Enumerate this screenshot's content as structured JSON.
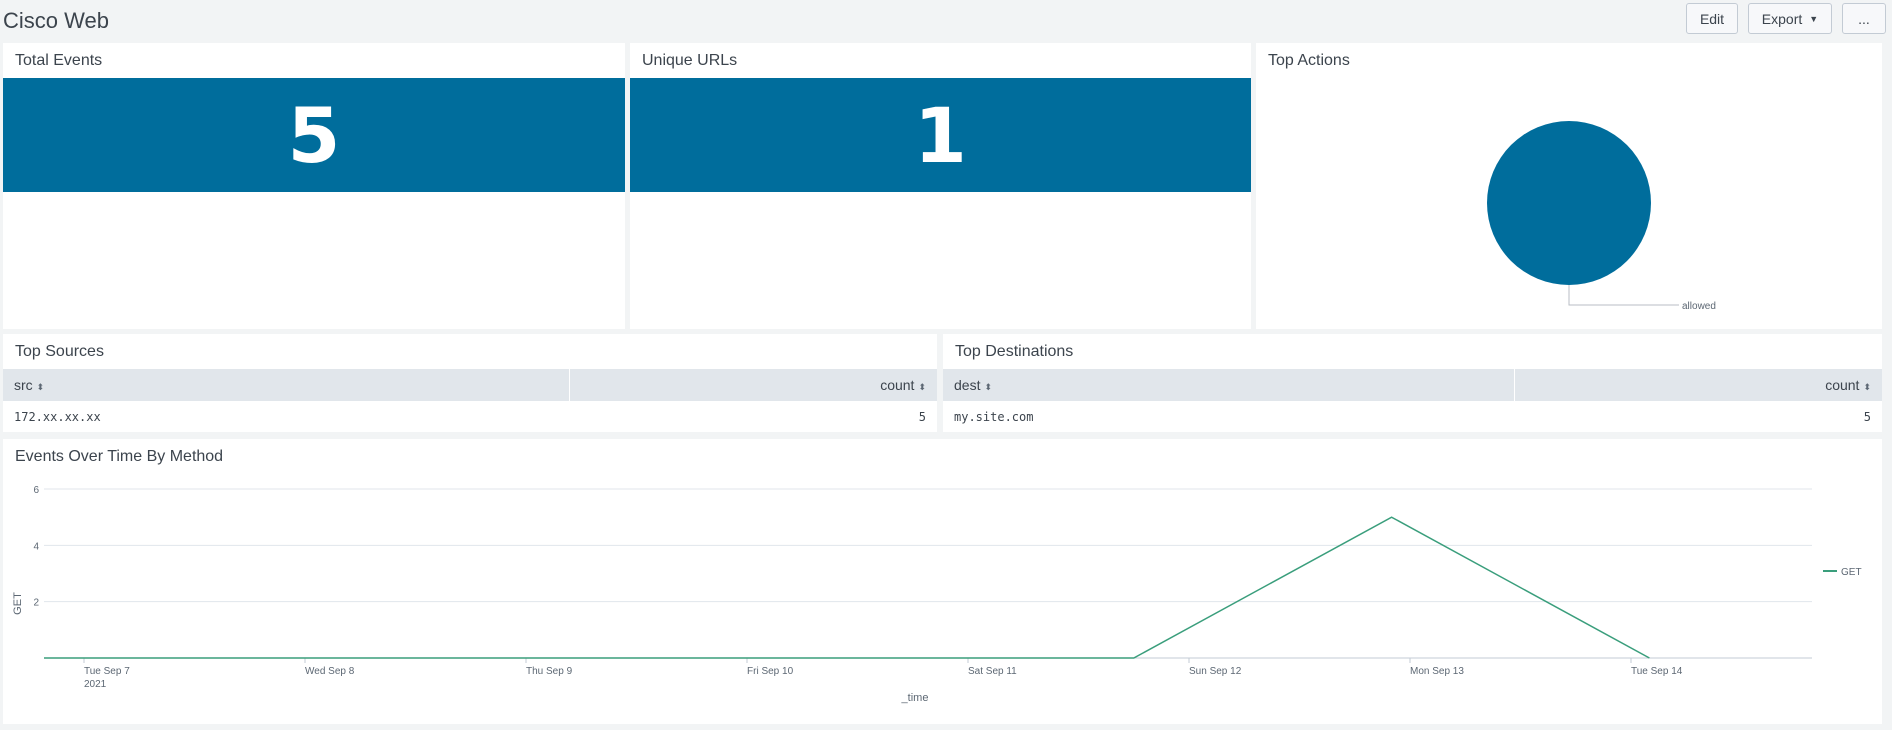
{
  "dashboard": {
    "title": "Cisco Web",
    "buttons": {
      "edit": "Edit",
      "export": "Export",
      "more": "..."
    }
  },
  "panels": {
    "total_events": {
      "title": "Total Events",
      "value": "5"
    },
    "unique_urls": {
      "title": "Unique URLs",
      "value": "1"
    },
    "top_actions": {
      "title": "Top Actions"
    },
    "top_sources": {
      "title": "Top Sources",
      "columns": [
        "src",
        "count"
      ],
      "rows": [
        {
          "src": "172.xx.xx.xx",
          "count": "5"
        }
      ]
    },
    "top_destinations": {
      "title": "Top Destinations",
      "columns": [
        "dest",
        "count"
      ],
      "rows": [
        {
          "dest": "my.site.com",
          "count": "5"
        }
      ]
    },
    "events_over_time": {
      "title": "Events Over Time By Method"
    }
  },
  "colors": {
    "accent": "#006d9c",
    "series_get": "#3a9e7c",
    "background": "#f2f4f5"
  },
  "icons": {
    "sort": "sort-icon",
    "caret": "caret-down-icon"
  },
  "chart_data": [
    {
      "type": "pie",
      "labels": [
        "allowed"
      ],
      "values": [
        5
      ],
      "colors": [
        "#006d9c"
      ]
    },
    {
      "type": "line",
      "xlabel": "_time",
      "ylabel": "GET",
      "x": [
        "Tue Sep 7",
        "Wed Sep 8",
        "Thu Sep 9",
        "Fri Sep 10",
        "Sat Sep 11",
        "Sun Sep 12",
        "Mon Sep 13",
        "Tue Sep 14"
      ],
      "x_year": "2021",
      "ylim": [
        0,
        6
      ],
      "yticks": [
        2,
        4,
        6
      ],
      "series": [
        {
          "name": "GET",
          "points": [
            {
              "x": "2021-09-07",
              "y": 0
            },
            {
              "x": "2021-09-11 18:00",
              "y": 0
            },
            {
              "x": "2021-09-12 22:00",
              "y": 5
            },
            {
              "x": "2021-09-14 02:00",
              "y": 0
            }
          ]
        }
      ],
      "legend": "right"
    }
  ]
}
